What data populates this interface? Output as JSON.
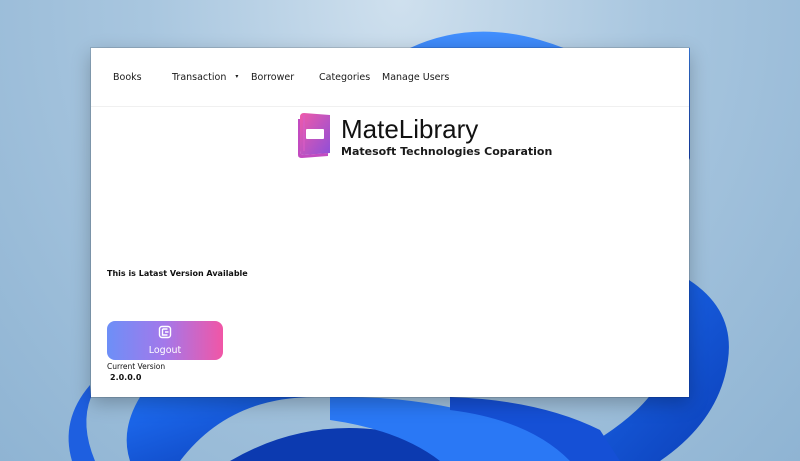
{
  "menu": {
    "items": [
      {
        "label": "Books"
      },
      {
        "label": "Transaction",
        "has_dropdown": true
      },
      {
        "label": "Borrower"
      },
      {
        "label": "Categories"
      },
      {
        "label": "Manage Users"
      }
    ],
    "dropdown_caret": "▾"
  },
  "brand": {
    "name": "MateLibrary",
    "company": "Matesoft Technologies Coparation",
    "logo_icon": "book-icon"
  },
  "status": {
    "message": "This is Latast Version Available"
  },
  "logout_button": {
    "label": "Logout",
    "icon": "logout-icon"
  },
  "version": {
    "label": "Current Version",
    "value": "2.0.0.0"
  },
  "colors": {
    "logout_gradient_start": "#6d8ff7",
    "logout_gradient_end": "#f156a6",
    "logo_pink": "#e05ab8",
    "logo_purple": "#9b4fd6"
  }
}
